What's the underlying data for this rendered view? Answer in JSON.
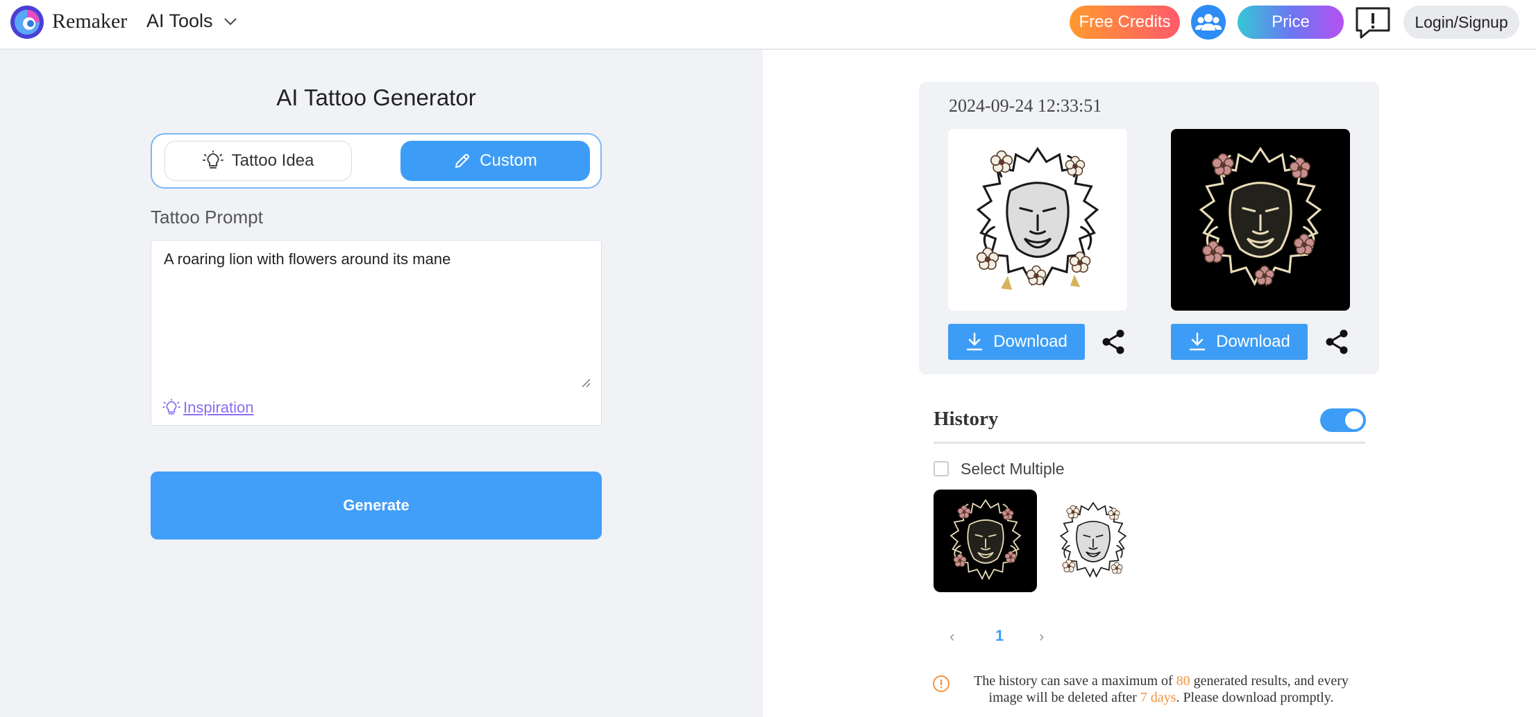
{
  "header": {
    "brand": "Remaker",
    "menu_label": "AI Tools",
    "free_credits_label": "Free Credits",
    "price_label": "Price",
    "login_label": "Login/Signup"
  },
  "generator": {
    "title": "AI Tattoo Generator",
    "tabs": [
      {
        "label": "Tattoo Idea",
        "active": false
      },
      {
        "label": "Custom",
        "active": true
      }
    ],
    "prompt_label": "Tattoo Prompt",
    "prompt_value": "A roaring lion with flowers around its mane",
    "inspiration_label": "Inspiration",
    "generate_label": "Generate"
  },
  "result": {
    "timestamp": "2024-09-24 12:33:51",
    "images": [
      {
        "description": "lion tattoo on white background",
        "download_label": "Download"
      },
      {
        "description": "lion tattoo on black background",
        "download_label": "Download"
      }
    ]
  },
  "history": {
    "title": "History",
    "toggle_on": true,
    "select_multiple_label": "Select Multiple",
    "current_page": "1",
    "notice": {
      "part1": "The history can save a maximum of ",
      "max_count": "80",
      "part2": " generated results, and every image will be deleted after ",
      "days": "7 days",
      "part3": ". Please download promptly."
    }
  },
  "colors": {
    "accent": "#3d9df6",
    "free_credits_start": "#ff9a2e",
    "free_credits_end": "#ff5a6b",
    "highlight": "#f5923c",
    "panel_bg": "#f0f2f5"
  }
}
